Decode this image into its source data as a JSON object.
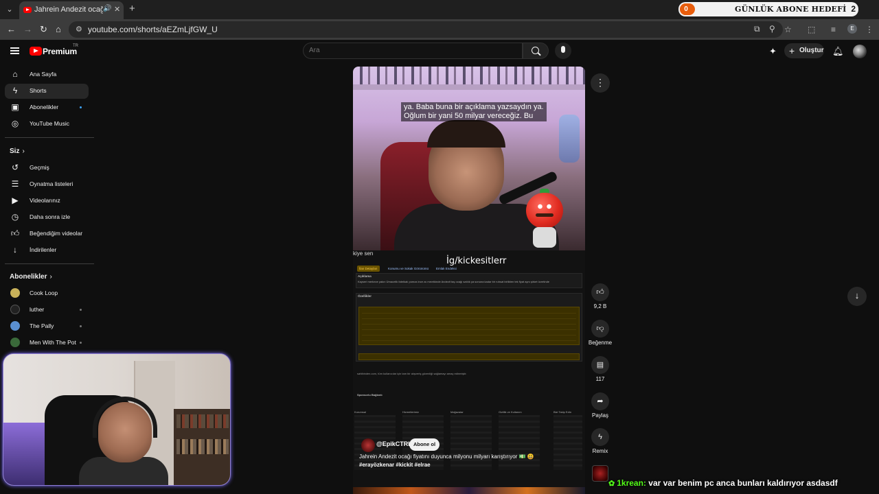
{
  "browser": {
    "tab_title": "Jahrein Andezit ocağı fiyatı",
    "url": "youtube.com/shorts/aEZmLjfGW_U",
    "profile_initial": "E",
    "goal_widget": {
      "count": "0",
      "title": "GÜNLÜK ABONE HEDEFİ",
      "target": "2"
    }
  },
  "masthead": {
    "logo_text": "Premium",
    "country_code": "TR",
    "search_placeholder": "Ara",
    "create_label": "Oluştur"
  },
  "sidebar": {
    "main_items": [
      {
        "label": "Ana Sayfa",
        "icon": "home-icon"
      },
      {
        "label": "Shorts",
        "icon": "shorts-icon"
      },
      {
        "label": "Abonelikler",
        "icon": "subscriptions-icon"
      },
      {
        "label": "YouTube Music",
        "icon": "music-icon"
      }
    ],
    "you_heading": "Siz",
    "you_items": [
      {
        "label": "Geçmiş",
        "icon": "history-icon"
      },
      {
        "label": "Oynatma listeleri",
        "icon": "playlists-icon"
      },
      {
        "label": "Videolarınız",
        "icon": "your-videos-icon"
      },
      {
        "label": "Daha sonra izle",
        "icon": "watch-later-icon"
      },
      {
        "label": "Beğendiğim videolar",
        "icon": "liked-icon"
      },
      {
        "label": "İndirilenler",
        "icon": "download-icon"
      }
    ],
    "subs_heading": "Abonelikler",
    "subs_items": [
      {
        "label": "Cook Loop",
        "color": "#c9b25a"
      },
      {
        "label": "luther",
        "color": "#222222"
      },
      {
        "label": "The Pally",
        "color": "#5a8fd0"
      },
      {
        "label": "Men With The Pot",
        "color": "#3a6a3a"
      }
    ]
  },
  "video": {
    "caption_line1": "ya. Baba buna bir açıklama yazsaydın ya.",
    "caption_line2": "Oğlum bir yani 50 milyar vereceğiz. Bu",
    "overlay_label": "İg/kickesitlerr",
    "kiye_text": "kiye sen",
    "web_tabs": [
      "İlan Detayları",
      "Konumu ve Sokak Görünümü",
      "Emlak Endeksi"
    ],
    "section_desc_title": "Açıklama",
    "section_desc_text": "Kayseri merkeze yakın Ürnacelik fabrikalı pomza ince zu mevrikinde Andezit taş ocağı satılık ya sonuna kadar bir ruhsat birlikten tek fiyat aynı şirket ücretinde",
    "section_features_title": "Özellikler",
    "web_notice": "sahibinden.com, tüm kullanıcılar için tam bir alışveriş güvenliği sağlamayı amaç edinmiştir.",
    "web_sponsor": "Sponsorlu Bağlantı",
    "footer_titles": [
      "Kurumsal",
      "Hizmetlerimiz",
      "Mağazalar",
      "Gizlilik ve Kullanım",
      "Bizi Takip Edin"
    ],
    "channel_name": "@EpikCTRL",
    "subscribe_label": "Abone ol",
    "title": "Jahrein Andezit ocağı fiyatını duyunca milyonu milyarı karıştırıyor 💵 😃",
    "hashtags": "#erayözkenar #kickit #elrae"
  },
  "actions": {
    "likes": "9,2 B",
    "dislike_label": "Beğenme",
    "comments": "117",
    "share_label": "Paylaş",
    "remix_label": "Remix"
  },
  "chat": {
    "user": "1krean:",
    "message": "var var benim pc anca bunları kaldırıyor asdasdf"
  }
}
